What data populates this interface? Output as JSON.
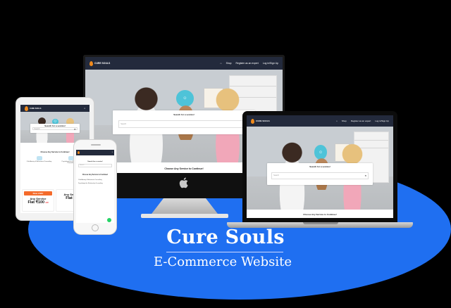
{
  "brand": {
    "logo_text": "CURE SOULS",
    "accent_color": "#f08a1c",
    "nav_color": "#232a3c",
    "ellipse_color": "#1f6ff1"
  },
  "nav": {
    "items": [
      "Shop",
      "Register as an expert",
      "Log in/Sign Up"
    ]
  },
  "hero": {
    "search_title": "Search for a service!",
    "search_placeholder": "Search",
    "search_icon": "close-icon"
  },
  "section": {
    "choose_heading": "Choose Any Service to Continue!"
  },
  "tablet": {
    "categories": [
      "Child Anxiety & Behavioural Counselling",
      "Psychologist for Relationship Counselling"
    ],
    "offer_ribbon": "Now LIVE!",
    "offers": [
      {
        "label": "Any Service",
        "price": "Flat ₹100",
        "suffix": "Off"
      },
      {
        "label": "Any Service",
        "price": "Flat ₹1",
        "suffix": ""
      }
    ]
  },
  "phone": {
    "categories": [
      "Child Anxiety & Behavioural Counselling",
      "Psychologist for Relationship Counselling"
    ]
  },
  "caption": {
    "title": "Cure Souls",
    "subtitle": "E-Commerce Website"
  }
}
